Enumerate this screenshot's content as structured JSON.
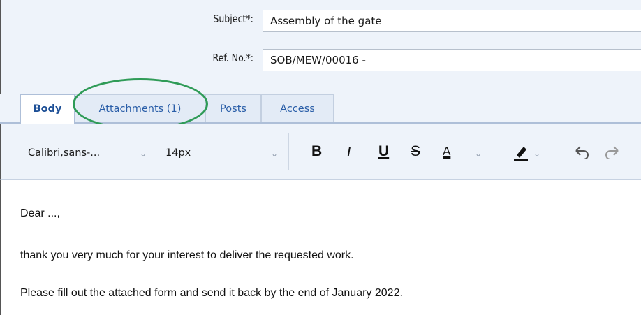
{
  "form": {
    "subject_label": "Subject*:",
    "subject_value": "Assembly of the gate",
    "ref_label": "Ref. No.*:",
    "ref_value": "SOB/MEW/00016 -"
  },
  "tabs": [
    {
      "label": "Body",
      "active": true
    },
    {
      "label": "Attachments (1)",
      "active": false,
      "highlighted": true
    },
    {
      "label": "Posts",
      "active": false
    },
    {
      "label": "Access",
      "active": false
    }
  ],
  "toolbar": {
    "font_family": "Calibri,sans-...",
    "font_size": "14px",
    "bold": "B",
    "italic": "I",
    "underline": "U",
    "strike": "S",
    "font_color": "A"
  },
  "body": {
    "line1": "Dear ...,",
    "line2": "thank you very much for your interest to deliver the requested work.",
    "line3": "Please fill out the attached form and send it back by the end of January 2022."
  },
  "colors": {
    "highlight": "#2f9b57",
    "tab_text": "#2a5ea8",
    "panel_bg": "#eef3fa"
  }
}
